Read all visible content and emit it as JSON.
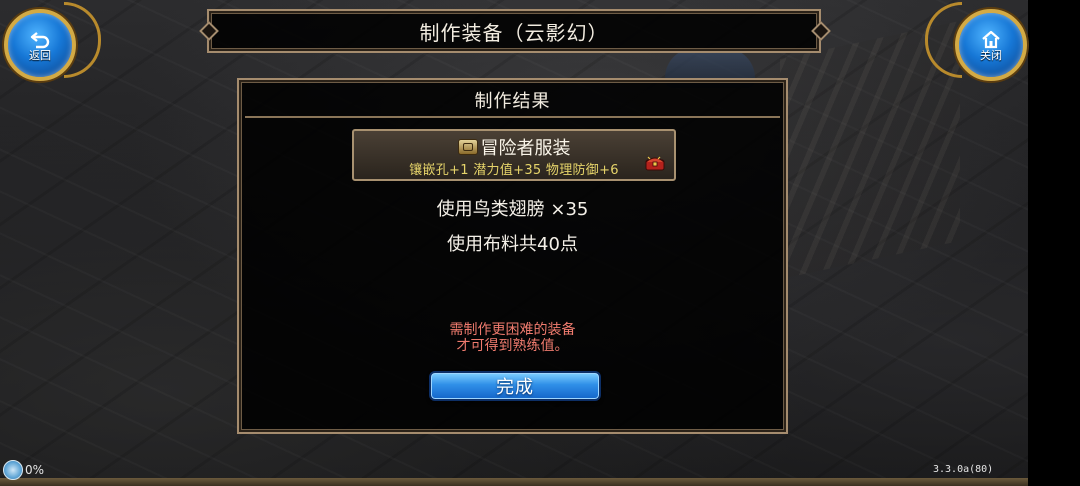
{
  "top_bar": {
    "back_label": "返回",
    "title": "制作装备（云影幻）",
    "close_label": "关闭"
  },
  "dialog": {
    "title": "制作结果",
    "item": {
      "name": "冒险者服装",
      "stats": "镶嵌孔+1  潜力值+35  物理防御+6",
      "icon": "clothing-icon",
      "badge_icon": "treasure-chest-icon"
    },
    "use_material": "使用鸟类翅膀  ×35",
    "use_cloth": "使用布料共40点",
    "hint_line1": "需制作更困难的装备",
    "hint_line2": "才可得到熟练值。",
    "done_label": "完成"
  },
  "status": {
    "network_percent": "0%",
    "version": "3.3.0a(80)"
  },
  "colors": {
    "panel_border": "#a58c6e",
    "stat_text": "#e6d46a",
    "hint_text": "#ef7b6e",
    "button_blue": "#2f8fe8",
    "corner_gold": "#d3aa45"
  }
}
